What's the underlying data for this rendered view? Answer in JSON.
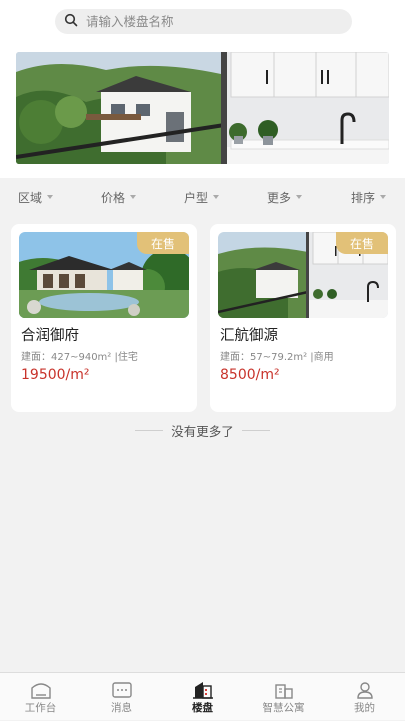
{
  "search": {
    "placeholder": "请输入楼盘名称"
  },
  "filters": [
    {
      "label": "区域"
    },
    {
      "label": "价格"
    },
    {
      "label": "户型"
    },
    {
      "label": "更多"
    },
    {
      "label": "排序"
    }
  ],
  "listings": [
    {
      "name": "合润御府",
      "status": "在售",
      "meta": "建面：427~940m²  |住宅",
      "price": "19500/m²"
    },
    {
      "name": "汇航御源",
      "status": "在售",
      "meta": "建面：57~79.2m²  |商用",
      "price": "8500/m²"
    }
  ],
  "no_more_text": "没有更多了",
  "tabbar": {
    "items": [
      {
        "label": "工作台",
        "icon": "workbench-icon"
      },
      {
        "label": "消息",
        "icon": "message-icon"
      },
      {
        "label": "楼盘",
        "icon": "building-icon",
        "active": true
      },
      {
        "label": "智慧公寓",
        "icon": "apartment-icon"
      },
      {
        "label": "我的",
        "icon": "profile-icon"
      }
    ]
  },
  "colors": {
    "price": "#c8332b",
    "badge": "#e2c178",
    "background": "#f2f2f2"
  }
}
